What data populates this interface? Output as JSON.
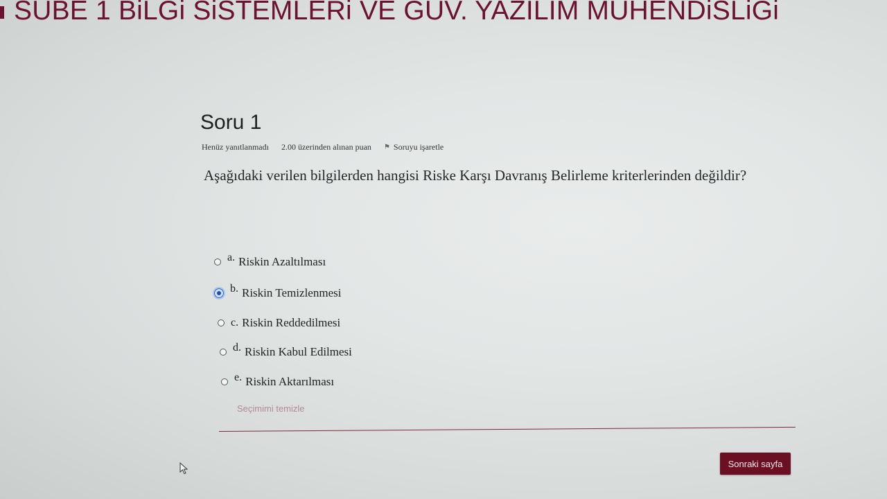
{
  "header": {
    "course_title": "SUBE 1 BiLGi SiSTEMLERi VE GUV. YAZILIM MUHENDiSLiGi"
  },
  "question": {
    "heading": "Soru 1",
    "status": "Henüz yanıtlanmadı",
    "points": "2.00 üzerinden alınan puan",
    "flag_label": "Soruyu işaretle",
    "flag_icon": "flag-icon",
    "text": "Aşağıdaki verilen bilgilerden hangisi Riske Karşı Davranış Belirleme kriterlerinden değildir?"
  },
  "options": [
    {
      "letter": "a.",
      "label": "Riskin Azaltılması",
      "selected": false
    },
    {
      "letter": "b.",
      "label": "Riskin Temizlenmesi",
      "selected": true
    },
    {
      "letter": "c.",
      "label": "Riskin Reddedilmesi",
      "selected": false
    },
    {
      "letter": "d.",
      "label": "Riskin Kabul Edilmesi",
      "selected": false
    },
    {
      "letter": "e.",
      "label": "Riskin Aktarılması",
      "selected": false
    }
  ],
  "clear_choice_label": "Seçimimi temizle",
  "next_button_label": "Sonraki sayfa",
  "colors": {
    "brand": "#6a1022",
    "title": "#6b1230",
    "selected_radio": "#1d4fa6"
  }
}
